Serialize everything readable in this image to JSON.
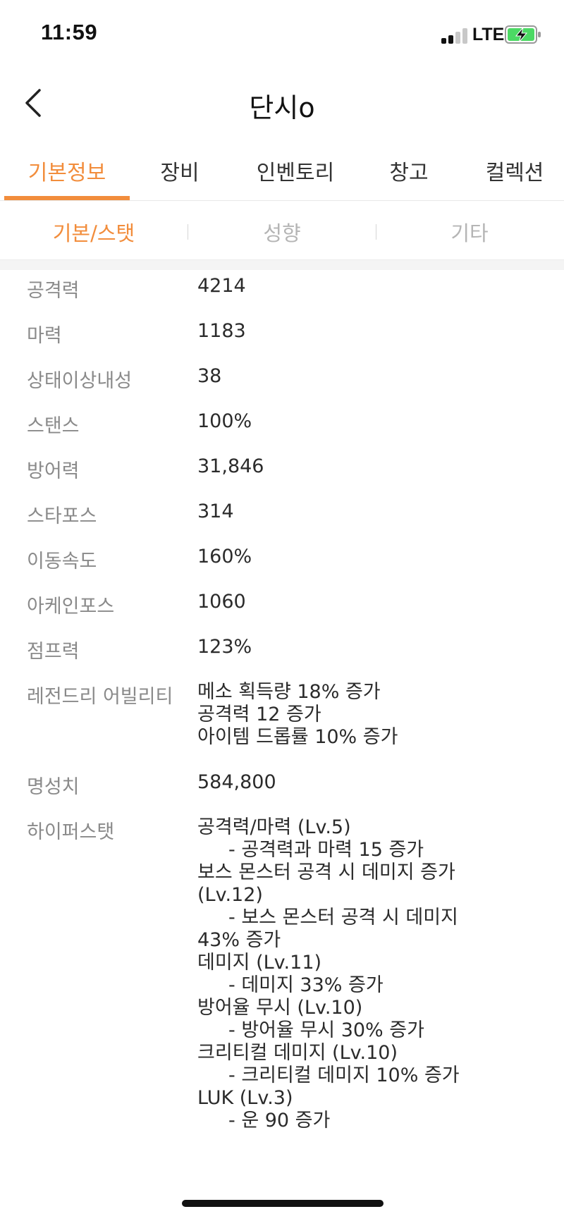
{
  "status": {
    "time": "11:59",
    "network": "LTE",
    "colors": {
      "battery": "#4cd964",
      "signal_active": "#111111",
      "signal_inactive": "#c8c8c8"
    }
  },
  "nav": {
    "title": "단시o",
    "back_icon": "chevron-left-icon"
  },
  "tabs": [
    {
      "label": "기본정보",
      "active": true
    },
    {
      "label": "장비"
    },
    {
      "label": "인벤토리"
    },
    {
      "label": "창고"
    },
    {
      "label": "컬렉션"
    }
  ],
  "subtabs": [
    {
      "label": "기본/스탯",
      "active": true
    },
    {
      "label": "성향"
    },
    {
      "label": "기타"
    }
  ],
  "accent_color": "#f28d3c",
  "stats": [
    {
      "label": "공격력",
      "value": "4214"
    },
    {
      "label": "마력",
      "value": "1183"
    },
    {
      "label": "상태이상내성",
      "value": "38"
    },
    {
      "label": "스탠스",
      "value": "100%"
    },
    {
      "label": "방어력",
      "value": "31,846"
    },
    {
      "label": "스타포스",
      "value": "314"
    },
    {
      "label": "이동속도",
      "value": "160%"
    },
    {
      "label": "아케인포스",
      "value": "1060"
    },
    {
      "label": "점프력",
      "value": "123%"
    }
  ],
  "legendary_ability": {
    "label": "레전드리 어빌리티",
    "lines": [
      "메소 획득량 18% 증가",
      "공격력 12 증가",
      "아이템 드롭률 10% 증가"
    ]
  },
  "fame": {
    "label": "명성치",
    "value": "584,800"
  },
  "hyper_stat": {
    "label": "하이퍼스탯",
    "lines": [
      {
        "text": "공격력/마력 (Lv.5)",
        "indent": false
      },
      {
        "text": "- 공격력과 마력 15 증가",
        "indent": true
      },
      {
        "text": "보스 몬스터 공격 시 데미지 증가",
        "indent": false
      },
      {
        "text": "(Lv.12)",
        "indent": false
      },
      {
        "text": "- 보스 몬스터 공격 시 데미지",
        "indent": true
      },
      {
        "text": "43% 증가",
        "indent": false
      },
      {
        "text": "데미지 (Lv.11)",
        "indent": false
      },
      {
        "text": "- 데미지 33% 증가",
        "indent": true
      },
      {
        "text": "방어율 무시 (Lv.10)",
        "indent": false
      },
      {
        "text": "- 방어율 무시 30% 증가",
        "indent": true
      },
      {
        "text": "크리티컬 데미지 (Lv.10)",
        "indent": false
      },
      {
        "text": "- 크리티컬 데미지 10% 증가",
        "indent": true
      },
      {
        "text": "LUK (Lv.3)",
        "indent": false
      },
      {
        "text": "- 운 90 증가",
        "indent": true
      }
    ]
  }
}
